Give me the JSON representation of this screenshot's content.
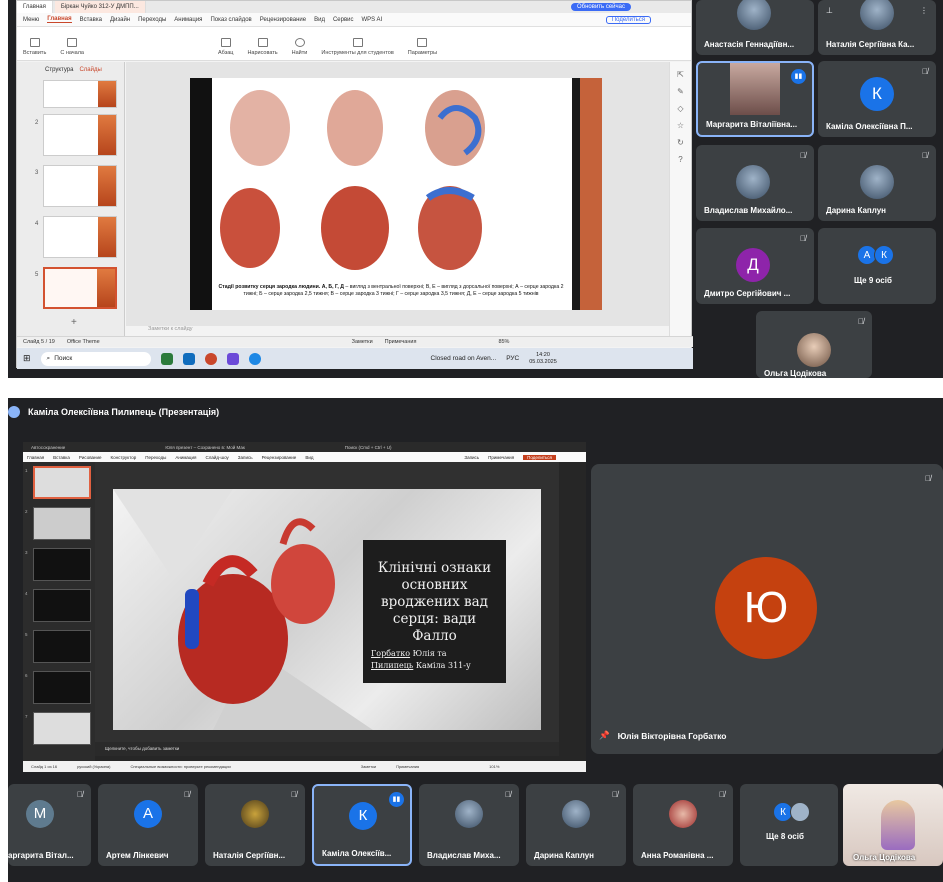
{
  "top": {
    "wps": {
      "tabs": [
        "Главная",
        "Біркан Чуйко 312-У ДМПП..."
      ],
      "update_button": "Обновить сейчас",
      "menu": [
        "Меню",
        "Главная",
        "Вставка",
        "Дизайн",
        "Переходы",
        "Анимация",
        "Показ слайдов",
        "Рецензирование",
        "Вид",
        "Сервис",
        "WPS AI"
      ],
      "share": "Поделиться",
      "ribbon": [
        "Вставить",
        "С начала",
        "Абзац",
        "Нарисовать",
        "Найти",
        "Инструменты для студентов",
        "Параметры"
      ],
      "left_tabs": [
        "Структура",
        "Слайды"
      ],
      "slide_numbers": [
        "1",
        "2",
        "3",
        "4",
        "5"
      ],
      "slide_caption_bold": "Стадії розвитку серця зародка людини. А, Б, Г, Д",
      "slide_caption": "– вигляд з вентральної поверхні; В, Е – вигляд з дорсальної поверхні; А – серце зародка 2 тижні; Б – серце зародка 2,5 тижня; В – серце зародка 3 тижні; Г – серце зародка 3,5 тижня; Д, Е – серце зародка 5 тижнів",
      "notes_placeholder": "Заметки к слайду",
      "status": {
        "slide": "Слайд 5 / 19",
        "theme": "Office Theme",
        "notes": "Заметки",
        "comments": "Примечания",
        "zoom": "85%"
      },
      "taskbar": {
        "search": "Поиск",
        "weather": "Closed road on Aven...",
        "lang": "РУС",
        "time": "14:20",
        "date": "05.03.2025"
      }
    },
    "participants": [
      {
        "name": "Анастасія Геннадіївн...",
        "muted": false
      },
      {
        "name": "Наталія Сергіївна Ка...",
        "muted": false
      },
      {
        "name": "Маргарита Віталіївна...",
        "muted": false,
        "speaking": true
      },
      {
        "name": "Каміла Олексіївна П...",
        "initial": "К",
        "color": "#1a73e8",
        "muted": true
      },
      {
        "name": "Владислав Михайло...",
        "muted": true
      },
      {
        "name": "Дарина Каплун",
        "muted": true
      },
      {
        "name": "Дмитро Сергійович ...",
        "initial": "Д",
        "color": "#8e24aa",
        "muted": true
      },
      {
        "name": "Ще 9 осіб",
        "initials": [
          "А",
          "К"
        ]
      },
      {
        "name": "Ольга Цодікова",
        "muted": true
      }
    ]
  },
  "bottom": {
    "header": "Каміла Олексіївна Пилипець (Презентація)",
    "powerpoint": {
      "titlebar": [
        "Автосохранение",
        "Юля презент – Сохранено в: Мой Мак",
        "Поиск (Cmd + Ctrl + U)"
      ],
      "menu": [
        "Главная",
        "Вставка",
        "Рисование",
        "Конструктор",
        "Переходы",
        "Анимация",
        "Слайд-шоу",
        "Запись",
        "Рецензирование",
        "Вид",
        "Запись",
        "Примечания",
        "Поделиться"
      ],
      "slide_numbers": [
        "1",
        "2",
        "3",
        "4",
        "5",
        "6",
        "7",
        "8"
      ],
      "slide_title": "Клінічні ознаки основних вроджених вад серця: вади Фалло",
      "slide_authors_1": "Горбатко",
      "slide_authors_2": " Юлія та",
      "slide_authors_3": "Пилипець",
      "slide_authors_4": " Каміла 311-у",
      "notes": "Щелкните, чтобы добавить заметки",
      "status": [
        "Слайд 1 из 16",
        "русский (Украина)",
        "Специальные возможности: проверьте рекомендации",
        "Заметки",
        "Примечания",
        "101%"
      ]
    },
    "pinned": {
      "initial": "Ю",
      "name": "Юлія Вікторівна Горбатко",
      "color": "#c5410f"
    },
    "strip": [
      {
        "name": "аргарита Вітал...",
        "initial": "М",
        "color": "#5f7b8f"
      },
      {
        "name": "Артем Лінкевич",
        "initial": "А",
        "color": "#1a73e8"
      },
      {
        "name": "Наталія Сергіївн..."
      },
      {
        "name": "Каміла Олексіїв...",
        "initial": "К",
        "color": "#1a73e8",
        "speaking": true
      },
      {
        "name": "Владислав Миха..."
      },
      {
        "name": "Дарина Каплун"
      },
      {
        "name": "Анна Романівна ..."
      },
      {
        "name": "Ще 8 осіб",
        "initials": [
          "К"
        ]
      },
      {
        "name": "Ольга Цодікова"
      }
    ]
  }
}
